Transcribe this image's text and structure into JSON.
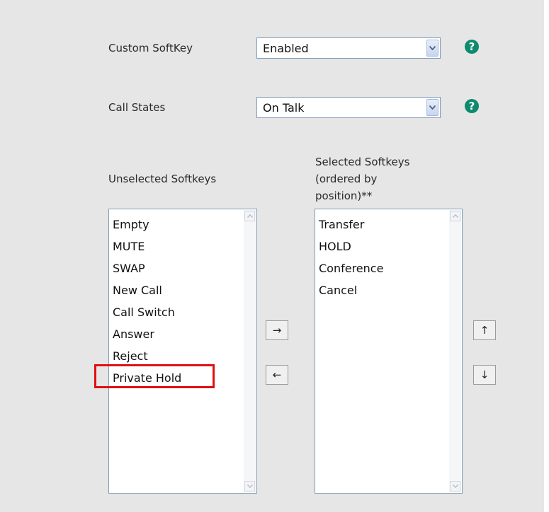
{
  "custom_softkey": {
    "label": "Custom SoftKey",
    "value": "Enabled",
    "help": "?"
  },
  "call_states": {
    "label": "Call States",
    "value": "On Talk",
    "help": "?"
  },
  "unselected": {
    "title": "Unselected Softkeys",
    "items": [
      "Empty",
      "MUTE",
      "SWAP",
      "New Call",
      "Call Switch",
      "Answer",
      "Reject",
      "Private Hold"
    ]
  },
  "selected": {
    "title_lines": [
      "Selected Softkeys",
      "(ordered by",
      "position)**"
    ],
    "items": [
      "Transfer",
      "HOLD",
      "Conference",
      "Cancel"
    ]
  },
  "buttons": {
    "move_right": "→",
    "move_left": "←",
    "move_up": "↑",
    "move_down": "↓"
  },
  "colors": {
    "panel_bg": "#e6e6e6",
    "help_icon": "#0e8a6e",
    "highlight": "#e01010",
    "border": "#7f9db9"
  }
}
